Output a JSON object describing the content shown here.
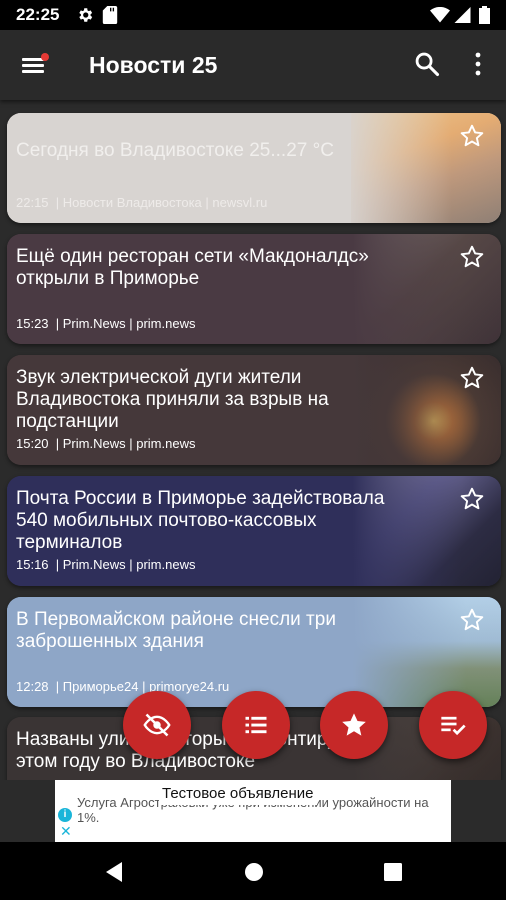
{
  "status_bar": {
    "time": "22:25"
  },
  "app_bar": {
    "title": "Новости 25"
  },
  "articles": [
    {
      "title": "Сегодня во Владивостоке 25...27 °C",
      "time": "22:15",
      "source": "Новости Владивостока",
      "site": "newsvl.ru"
    },
    {
      "title": "Ещё один ресторан сети «Макдоналдс» открыли в Приморье",
      "time": "15:23",
      "source": "Prim.News",
      "site": "prim.news"
    },
    {
      "title": "Звук электрической дуги жители Владивостока приняли за взрыв на подстанции",
      "time": "15:20",
      "source": "Prim.News",
      "site": "prim.news"
    },
    {
      "title": "Почта России в Приморье задействовала 540 мобильных почтово-кассовых терминалов",
      "time": "15:16",
      "source": "Prim.News",
      "site": "prim.news"
    },
    {
      "title": "В Первомайском районе снесли три заброшенных здания",
      "time": "12:28",
      "source": "Приморье24",
      "site": "primorye24.ru"
    },
    {
      "title": "Названы улицы, которые ремонтируют в этом году во Владивостоке",
      "time": "",
      "source": "",
      "site": ""
    }
  ],
  "ad": {
    "label": "Тестовое объявление",
    "text": "Услуга Агростраховки уже при изменении урожайности на 1%."
  },
  "colors": {
    "accent": "#c62828",
    "app_bar": "#2a2a2a",
    "status_bar": "#000000"
  }
}
